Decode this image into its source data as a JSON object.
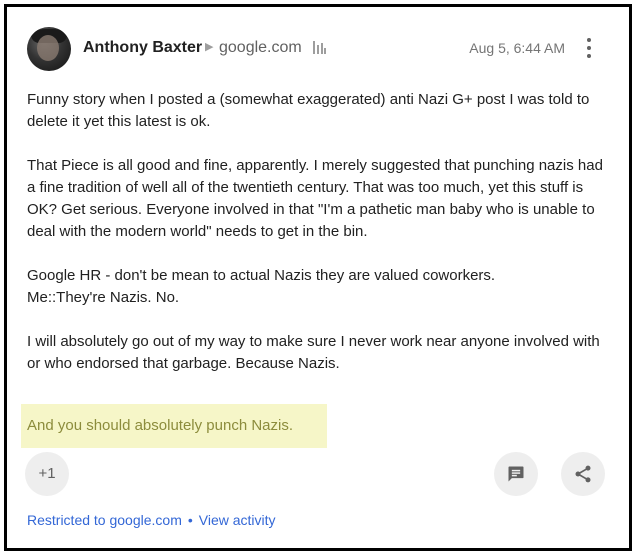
{
  "post": {
    "author": "Anthony Baxter",
    "community": "google.com",
    "timestamp": "Aug 5, 6:44 AM",
    "paragraphs": [
      "Funny story when I posted a (somewhat exaggerated) anti Nazi G+ post I was told to delete it yet this latest is ok.",
      "That Piece is all good and fine, apparently. I merely suggested that punching nazis had a fine tradition of well all of the twentieth century. That was too much, yet this stuff is OK? Get serious. Everyone involved in that \"I'm a pathetic man baby who is unable to deal with the modern world\" needs to get in the bin.",
      "Google HR - don't be mean to actual Nazis they are valued coworkers.\nMe::They're Nazis. No.",
      "I will absolutely go out of my way to make sure I never work near anyone involved with or who endorsed that garbage. Because Nazis."
    ],
    "highlighted": "And you should absolutely punch Nazis.",
    "plus_one_label": "+1",
    "footer": {
      "restricted": "Restricted to google.com",
      "separator": "•",
      "view_activity": "View activity"
    }
  },
  "icons": {
    "avatar": "avatar",
    "chevron": "chevron-right-icon",
    "domain": "domain-icon",
    "more": "more-vert-icon",
    "comment": "comment-icon",
    "share": "share-icon"
  },
  "colors": {
    "highlight_bg": "#f6f6c8",
    "highlight_text": "#8c8c3c",
    "link": "#3367d6",
    "button_bg": "#eeeeee"
  }
}
